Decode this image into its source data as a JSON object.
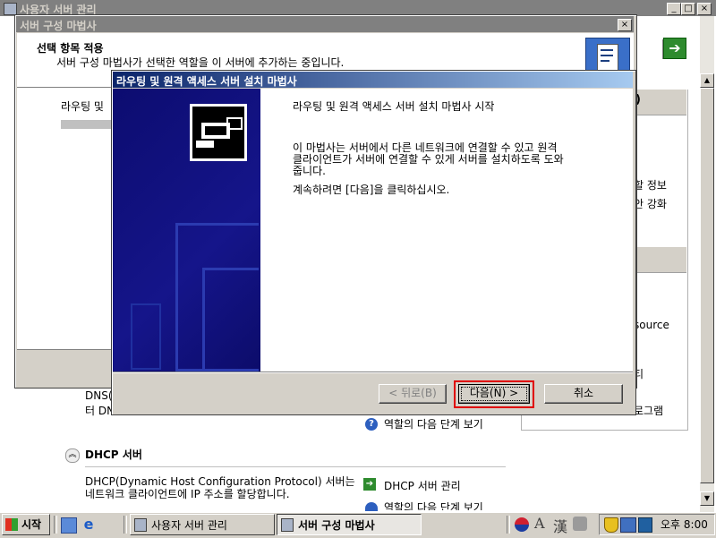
{
  "bg_window": {
    "title": "사용자 서버 관리"
  },
  "outer_wizard": {
    "title": "서버 구성 마법사",
    "header_title": "선택 항목 적용",
    "header_subtitle": "서버 구성 마법사가 선택한 역할을 이 서버에 추가하는 중입니다.",
    "progress_label": "라우팅 및"
  },
  "dialog": {
    "title": "라우팅 및 원격 액세스 서버 설치 마법사",
    "heading": "라우팅 및 원격 액세스 서버 설치 마법사 시작",
    "desc_line1": "이 마법사는 서버에서 다른 네트워크에 연결할 수 있고 원격",
    "desc_line2": "클라이언트가 서버에 연결할 수 있게 서버를 설치하도록 도와",
    "desc_line3": "줍니다.",
    "continue": "계속하려면 [다음]을 클릭하십시오.",
    "back_button": "< 뒤로(B)",
    "next_button": "다음(N) >",
    "cancel_button": "취소"
  },
  "right_panel": {
    "frag1": ")",
    "frag2": "할 정보",
    "frag3": "안 강화",
    "frag4": "source",
    "frag5": "티",
    "frag6": "로그램"
  },
  "background": {
    "dns_frag1": "DNS(",
    "dns_frag2": "터 DN",
    "next_steps_link": "역할의 다음 단계 보기",
    "dhcp_title": "DHCP 서버",
    "dhcp_desc1": "DHCP(Dynamic Host Configuration Protocol) 서버는",
    "dhcp_desc2": "네트워크 클라이언트에 IP 주소를 할당합니다.",
    "dhcp_manage_link": "DHCP 서버 관리",
    "dhcp_next_steps_link": "역할의 다음 단계 보기"
  },
  "taskbar": {
    "start": "시작",
    "task1": "사용자 서버 관리",
    "task2": "서버 구성 마법사",
    "ime_a": "A",
    "ime_han": "漢",
    "clock": "오후 8:00"
  },
  "colors": {
    "title_active": "#0a246a",
    "title_inactive": "#808080",
    "face": "#d4d0c8",
    "highlight_red": "#e00000"
  }
}
